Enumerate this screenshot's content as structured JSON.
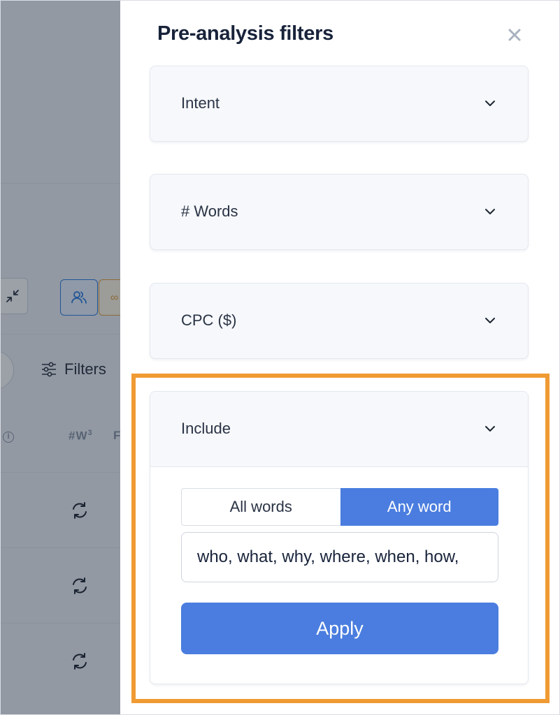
{
  "background_app": {
    "filters_label": "Filters",
    "column_header": "#W",
    "column_header_sup": "3",
    "column_header_2": "F"
  },
  "drawer": {
    "title": "Pre-analysis filters",
    "sections": {
      "intent": {
        "label": "Intent"
      },
      "words": {
        "label": "# Words"
      },
      "cpc": {
        "label": "CPC ($)"
      },
      "include": {
        "label": "Include",
        "mode_options": [
          "All words",
          "Any word"
        ],
        "mode_selected": "Any word",
        "input_value": "who, what, why, where, when, how,",
        "apply_label": "Apply"
      }
    }
  },
  "colors": {
    "accent": "#4a7ddf",
    "highlight": "#f09a33",
    "title": "#18233a"
  }
}
